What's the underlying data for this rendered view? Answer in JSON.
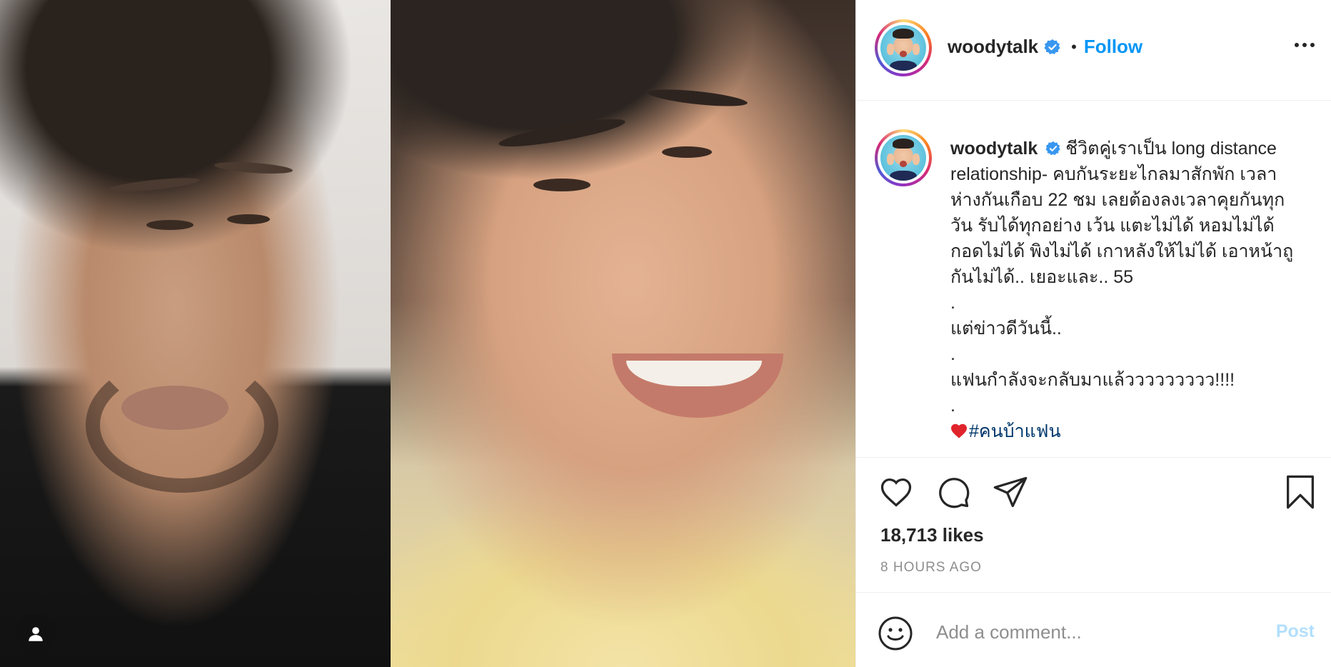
{
  "post": {
    "username": "woodytalk",
    "follow_label": "Follow",
    "separator": "•",
    "caption_lines": [
      "ชีวิตคู่เราเป็น long distance",
      "relationship- คบกันระยะไกลมาสักพัก เวลา",
      "ห่างกันเกือบ 22 ชม เลยต้องลงเวลาคุยกันทุก",
      "วัน รับได้ทุกอย่าง เว้น แตะไม่ได้ หอมไม่ได้",
      "กอดไม่ได้ พิงไม่ได้ เกาหลังให้ไม่ได้ เอาหน้าถู",
      "กันไม่ได้.. เยอะและ.. 55",
      ".",
      "แต่ข่าวดีวันนี้..",
      ".",
      "แฟนกำลังจะกลับมาแล้ววววววววว!!!!",
      "."
    ],
    "hashtag": "#คนบ้าแฟน",
    "likes": "18,713 likes",
    "timestamp": "8 HOURS AGO"
  },
  "comment": {
    "placeholder": "Add a comment...",
    "post_label": "Post"
  },
  "colors": {
    "accent": "#0095f6",
    "hashtag": "#00376b",
    "post_disabled": "#b2dffc",
    "muted": "#8e8e8e"
  },
  "icons": {
    "like": "heart-icon",
    "comment": "comment-icon",
    "share": "paper-plane-icon",
    "save": "bookmark-icon",
    "tag": "user-tag-icon",
    "emoji": "smiley-icon",
    "more": "more-options-icon",
    "verified": "verified-badge-icon"
  }
}
